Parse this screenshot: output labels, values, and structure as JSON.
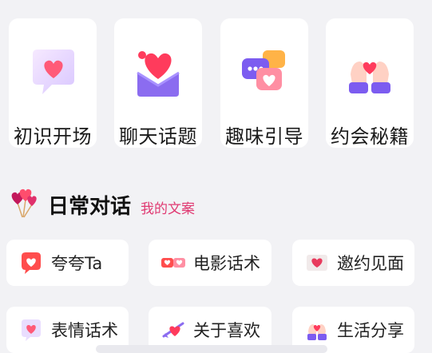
{
  "categories": [
    {
      "label": "初识开场",
      "icon": "heart-speech-bubble-icon"
    },
    {
      "label": "聊天话题",
      "icon": "love-letter-icon"
    },
    {
      "label": "趣味引导",
      "icon": "chat-bubbles-icon"
    },
    {
      "label": "约会秘籍",
      "icon": "hands-holding-heart-icon"
    }
  ],
  "section": {
    "title": "日常对话",
    "subtitle": "我的文案",
    "icon": "heart-balloons-icon"
  },
  "chips": [
    {
      "label": "夸夸Ta",
      "icon": "heart-bubble-icon"
    },
    {
      "label": "电影话术",
      "icon": "movie-hearts-icon"
    },
    {
      "label": "邀约见面",
      "icon": "heart-envelope-icon"
    },
    {
      "label": "表情话术",
      "icon": "heart-message-icon"
    },
    {
      "label": "关于喜欢",
      "icon": "heart-arrow-icon"
    },
    {
      "label": "生活分享",
      "icon": "heart-hands-icon"
    }
  ],
  "colors": {
    "accent_pink": "#e03a72",
    "heart": "#ff4d6d",
    "purple": "#8b6cf0",
    "background": "#f2f2f5"
  }
}
